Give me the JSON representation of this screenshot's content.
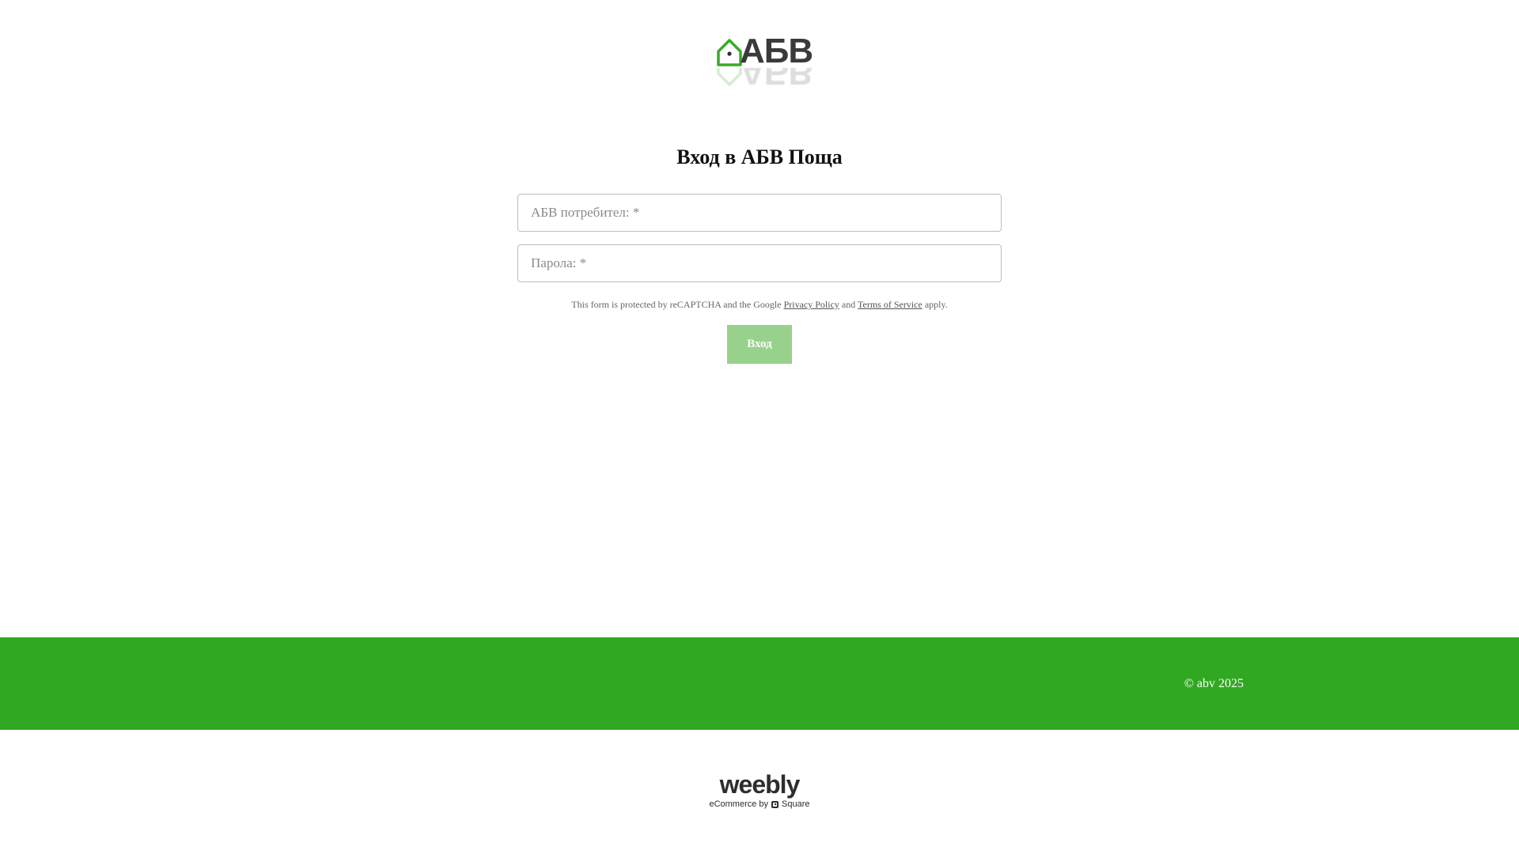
{
  "logo": {
    "text": "АБВ",
    "house_color": "#3aa82a",
    "icon": "house-icon"
  },
  "login": {
    "title": "Вход в АБВ Поща",
    "username_placeholder": "АБВ потребител: *",
    "password_placeholder": "Парола: *",
    "username_value": "",
    "password_value": "",
    "submit_label": "Вход",
    "submit_color": "#97d18b"
  },
  "recaptcha": {
    "prefix": "This form is protected by reCAPTCHA and the Google",
    "privacy_link": "Privacy Policy",
    "and": "and",
    "terms_link": "Terms of Service",
    "suffix": "apply."
  },
  "footer": {
    "copyright": "© abv 2025",
    "background_color": "#31a821"
  },
  "weebly_badge": {
    "brand": "weebly",
    "tagline_prefix": "eCommerce by",
    "tagline_brand": "Square",
    "icon": "square-logo-icon"
  }
}
